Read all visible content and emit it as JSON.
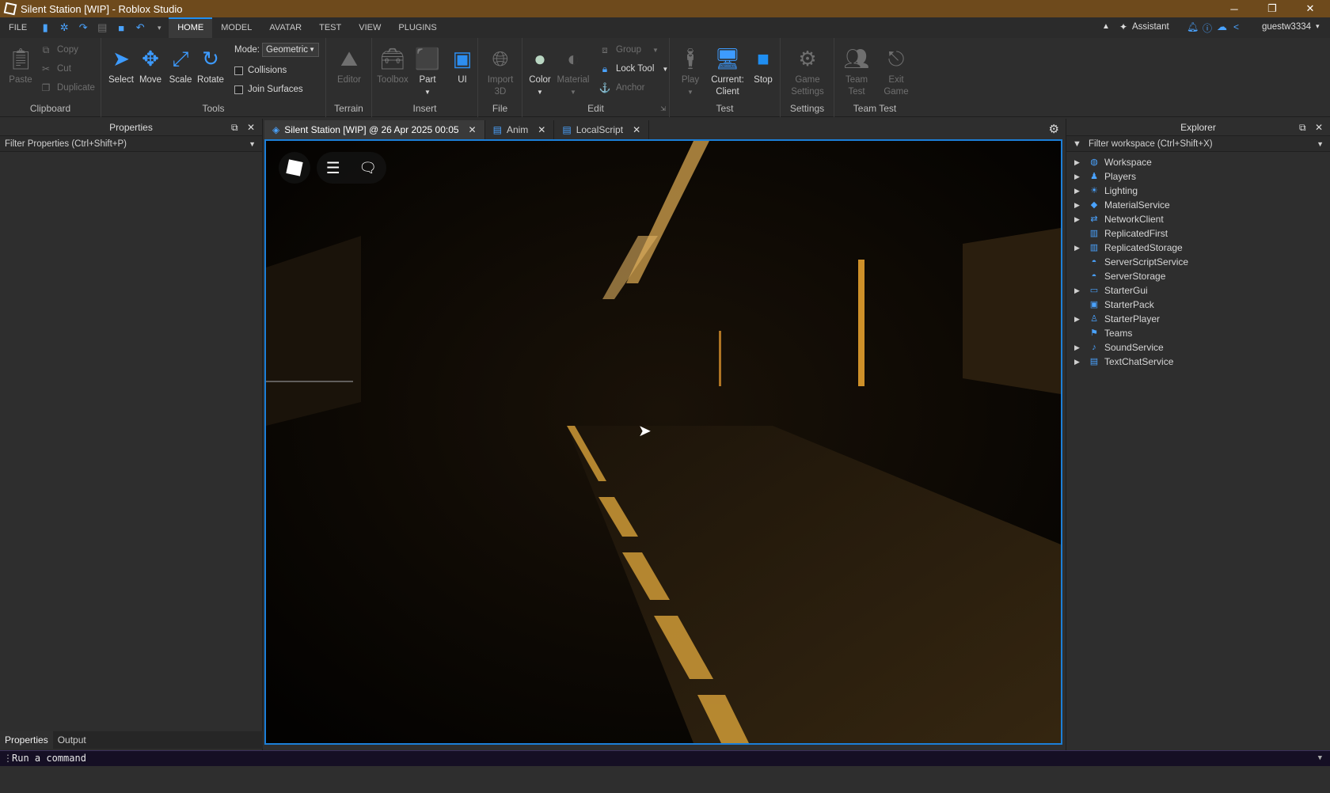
{
  "window": {
    "title": "Silent Station [WIP] - Roblox Studio",
    "minimize": "─",
    "maximize": "❐",
    "close": "✕"
  },
  "menubar": {
    "file": "FILE",
    "tabs": [
      "HOME",
      "MODEL",
      "AVATAR",
      "TEST",
      "VIEW",
      "PLUGINS"
    ],
    "assistant": "Assistant",
    "user": "guestw3334"
  },
  "ribbon": {
    "clipboard": {
      "label": "Clipboard",
      "paste": "Paste",
      "copy": "Copy",
      "cut": "Cut",
      "duplicate": "Duplicate"
    },
    "tools": {
      "label": "Tools",
      "select": "Select",
      "move": "Move",
      "scale": "Scale",
      "rotate": "Rotate",
      "mode_label": "Mode:",
      "mode_value": "Geometric",
      "collisions": "Collisions",
      "join_surfaces": "Join Surfaces"
    },
    "terrain": {
      "label": "Terrain",
      "editor": "Editor"
    },
    "insert": {
      "label": "Insert",
      "toolbox": "Toolbox",
      "part": "Part",
      "ui": "UI"
    },
    "file": {
      "label": "File",
      "import3d_1": "Import",
      "import3d_2": "3D"
    },
    "edit": {
      "label": "Edit",
      "color": "Color",
      "material": "Material",
      "group": "Group",
      "lock_tool": "Lock Tool",
      "anchor": "Anchor"
    },
    "test": {
      "label": "Test",
      "play": "Play",
      "current_client_1": "Current:",
      "current_client_2": "Client",
      "stop": "Stop"
    },
    "settings": {
      "label": "Settings",
      "game_settings_1": "Game",
      "game_settings_2": "Settings"
    },
    "teamtest": {
      "label": "Team Test",
      "team_test_1": "Team",
      "team_test_2": "Test",
      "exit_game_1": "Exit",
      "exit_game_2": "Game"
    }
  },
  "properties": {
    "title": "Properties",
    "filter": "Filter Properties (Ctrl+Shift+P)"
  },
  "bottom_tabs": [
    "Properties",
    "Output"
  ],
  "doc_tabs": [
    {
      "label": "Silent Station [WIP] @ 26 Apr 2025 00:05"
    },
    {
      "label": "Anim"
    },
    {
      "label": "LocalScript"
    }
  ],
  "explorer": {
    "title": "Explorer",
    "filter": "Filter workspace (Ctrl+Shift+X)",
    "items": [
      {
        "label": "Workspace",
        "expandable": true,
        "icon": "globe-icon"
      },
      {
        "label": "Players",
        "expandable": true,
        "icon": "players-icon"
      },
      {
        "label": "Lighting",
        "expandable": true,
        "icon": "lighting-icon"
      },
      {
        "label": "MaterialService",
        "expandable": true,
        "icon": "material-icon"
      },
      {
        "label": "NetworkClient",
        "expandable": true,
        "icon": "network-icon"
      },
      {
        "label": "ReplicatedFirst",
        "expandable": false,
        "icon": "replicated-first-icon"
      },
      {
        "label": "ReplicatedStorage",
        "expandable": true,
        "icon": "replicated-storage-icon"
      },
      {
        "label": "ServerScriptService",
        "expandable": false,
        "icon": "server-script-icon"
      },
      {
        "label": "ServerStorage",
        "expandable": false,
        "icon": "server-storage-icon"
      },
      {
        "label": "StarterGui",
        "expandable": true,
        "icon": "starter-gui-icon"
      },
      {
        "label": "StarterPack",
        "expandable": false,
        "icon": "starter-pack-icon"
      },
      {
        "label": "StarterPlayer",
        "expandable": true,
        "icon": "starter-player-icon"
      },
      {
        "label": "Teams",
        "expandable": false,
        "icon": "teams-icon"
      },
      {
        "label": "SoundService",
        "expandable": true,
        "icon": "sound-icon"
      },
      {
        "label": "TextChatService",
        "expandable": true,
        "icon": "text-chat-icon"
      }
    ]
  },
  "command_bar": {
    "placeholder": "Run a command"
  },
  "colors": {
    "accent": "#1f8ef1",
    "titlebar": "#6e4a1c",
    "viewport_border": "#1c7fd8"
  }
}
